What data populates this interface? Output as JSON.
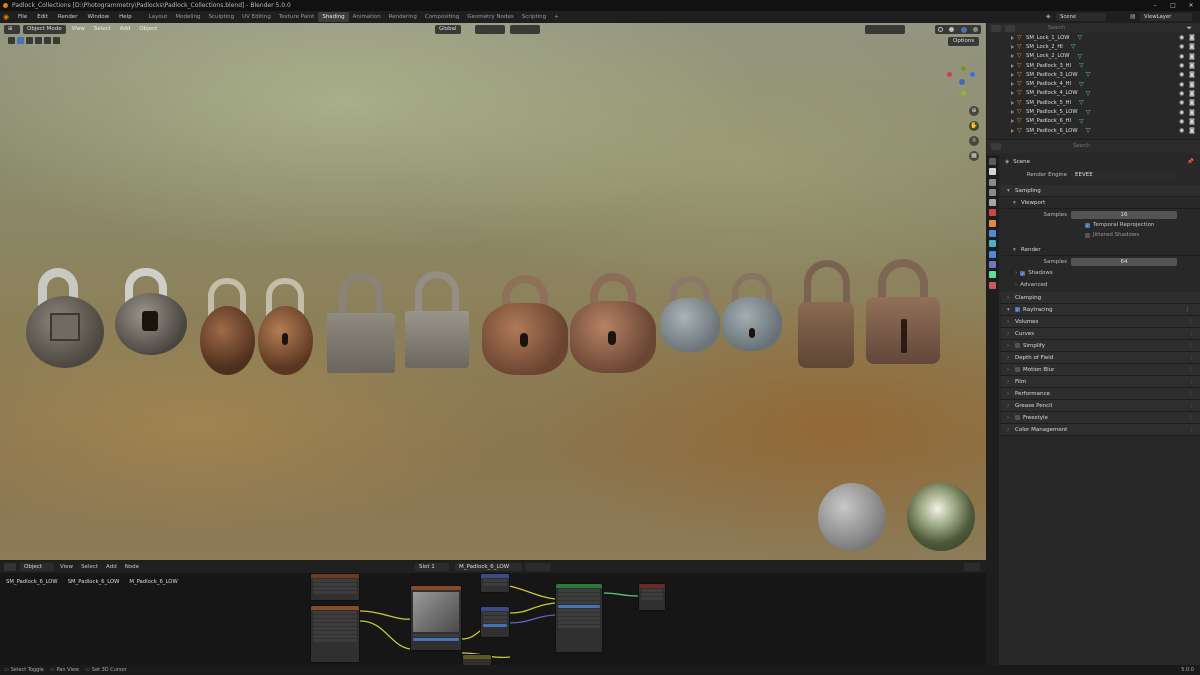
{
  "window": {
    "title": "Padlock_Collections [D:\\Photogrammetry\\Padlocks\\Padlock_Collections.blend] - Blender 5.0.0"
  },
  "menubar": {
    "menus": [
      "File",
      "Edit",
      "Render",
      "Window",
      "Help"
    ],
    "workspaces": [
      "Layout",
      "Modeling",
      "Sculpting",
      "UV Editing",
      "Texture Paint",
      "Shading",
      "Animation",
      "Rendering",
      "Compositing",
      "Geometry Nodes",
      "Scripting"
    ],
    "active_workspace": "Shading",
    "add_tab": "+",
    "scene": "Scene",
    "view_layer": "ViewLayer"
  },
  "viewport": {
    "mode": "Object Mode",
    "menus": [
      "View",
      "Select",
      "Add",
      "Object"
    ],
    "transform_orientation": "Global",
    "options_label": "Options"
  },
  "outliner": {
    "search_placeholder": "Search",
    "items": [
      {
        "name": "SM_Lock_1_LOW"
      },
      {
        "name": "SM_Lock_2_HI"
      },
      {
        "name": "SM_Lock_2_LOW"
      },
      {
        "name": "SM_Padlock_3_HI"
      },
      {
        "name": "SM_Padlock_3_LOW"
      },
      {
        "name": "SM_Padlock_4_HI"
      },
      {
        "name": "SM_Padlock_4_LOW"
      },
      {
        "name": "SM_Padlock_5_HI"
      },
      {
        "name": "SM_Padlock_5_LOW"
      },
      {
        "name": "SM_Padlock_6_HI"
      },
      {
        "name": "SM_Padlock_6_LOW"
      }
    ]
  },
  "properties": {
    "search_placeholder": "Search",
    "breadcrumb": "Scene",
    "render_engine_label": "Render Engine",
    "render_engine": "EEVEE",
    "sampling": {
      "label": "Sampling",
      "viewport_label": "Viewport",
      "samples_label": "Samples",
      "viewport_samples": "16",
      "temporal_reprojection": "Temporal Reprojection",
      "jittered_shadows": "Jittered Shadows",
      "render_label": "Render",
      "render_samples": "64",
      "shadows": "Shadows",
      "advanced": "Advanced"
    },
    "clamping": "Clamping",
    "raytracing": "Raytracing",
    "sections": [
      "Volumes",
      "Curves",
      "Simplify",
      "Depth of Field",
      "Motion Blur",
      "Film",
      "Performance",
      "Grease Pencil",
      "Freestyle",
      "Color Management"
    ]
  },
  "node_editor": {
    "type": "Object",
    "menus": [
      "View",
      "Select",
      "Add",
      "Node"
    ],
    "slot": "Slot 1",
    "material": "M_Padlock_6_LOW",
    "breadcrumb": [
      "SM_Padlock_6_LOW",
      "SM_Padlock_6_LOW",
      "M_Padlock_6_LOW"
    ]
  },
  "statusbar": {
    "items": [
      "Select Toggle",
      "Pan View",
      "Set 3D Cursor"
    ],
    "version": "5.0.0"
  },
  "colors": {
    "accent": "#4772b3",
    "object_orange": "#e08a3a",
    "material_green": "#5ddc9a"
  }
}
